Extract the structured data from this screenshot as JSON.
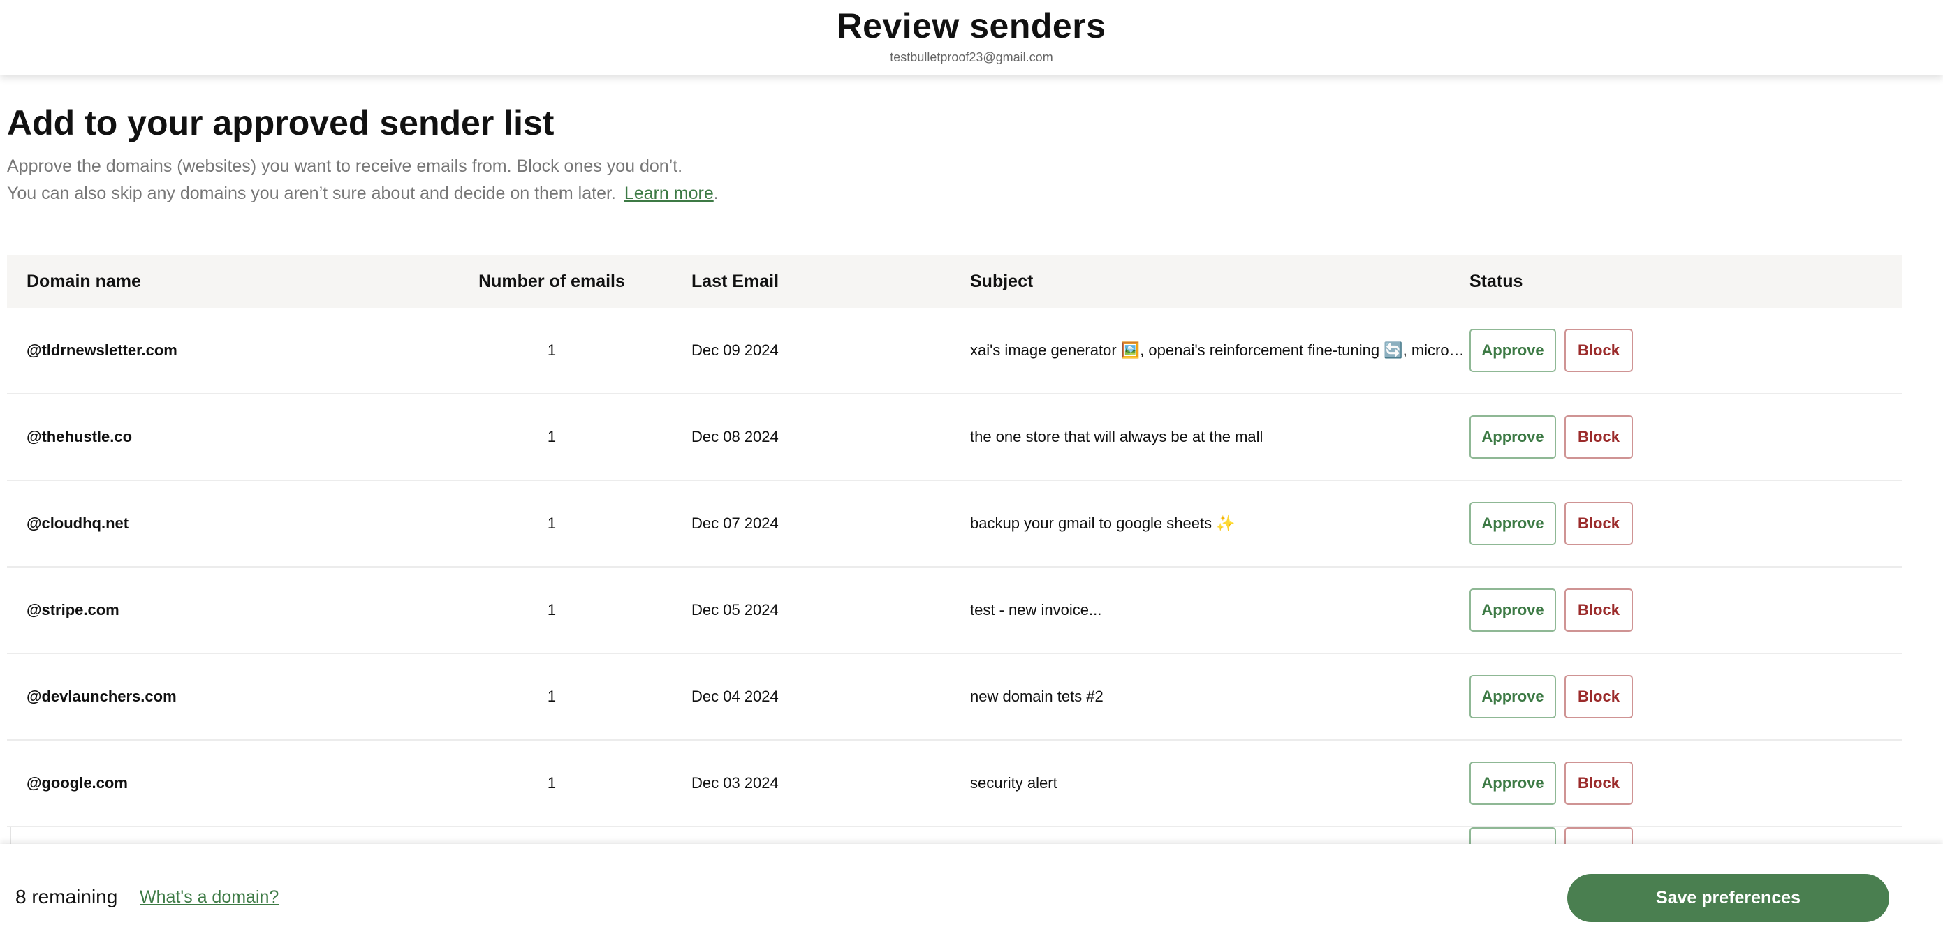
{
  "header": {
    "title": "Review senders",
    "email": "testbulletproof23@gmail.com"
  },
  "intro": {
    "title": "Add to your approved sender list",
    "line1": "Approve the domains (websites) you want to receive emails from. Block ones you don’t.",
    "line2": "You can also skip any domains you aren’t sure about and decide on them later.",
    "learn_more": "Learn more",
    "period": "."
  },
  "table": {
    "columns": {
      "domain": "Domain name",
      "count": "Number of emails",
      "last_email": "Last Email",
      "subject": "Subject",
      "status": "Status"
    },
    "approve_label": "Approve",
    "block_label": "Block",
    "rows": [
      {
        "domain": "@tldrnewsletter.com",
        "count": "1",
        "date": "Dec 09 2024",
        "subject": "xai's image generator 🖼️, openai's reinforcement fine-tuning 🔄, microsoft trellis..."
      },
      {
        "domain": "@thehustle.co",
        "count": "1",
        "date": "Dec 08 2024",
        "subject": "the one store that will always be at the mall"
      },
      {
        "domain": "@cloudhq.net",
        "count": "1",
        "date": "Dec 07 2024",
        "subject": "backup your gmail to google sheets ✨"
      },
      {
        "domain": "@stripe.com",
        "count": "1",
        "date": "Dec 05 2024",
        "subject": "test - new invoice..."
      },
      {
        "domain": "@devlaunchers.com",
        "count": "1",
        "date": "Dec 04 2024",
        "subject": "new domain tets #2"
      },
      {
        "domain": "@google.com",
        "count": "1",
        "date": "Dec 03 2024",
        "subject": "security alert"
      }
    ]
  },
  "footer": {
    "remaining": "8 remaining",
    "whats_domain": "What's a domain?",
    "save": "Save preferences"
  },
  "colors": {
    "accent_green": "#4a7f50",
    "approve_text": "#3d7a45",
    "block_text": "#9b2b2b",
    "header_row_bg": "#f6f5f3"
  }
}
